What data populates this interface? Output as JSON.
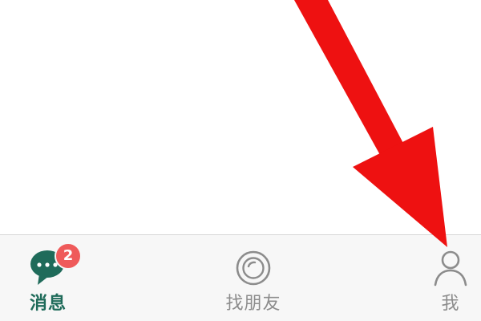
{
  "tabbar": {
    "tabs": [
      {
        "label": "消息",
        "icon": "chat-bubble-icon",
        "badge": "2",
        "active": true
      },
      {
        "label": "找朋友",
        "icon": "radar-icon",
        "active": false
      },
      {
        "label": "我",
        "icon": "person-icon",
        "active": false
      }
    ]
  },
  "colors": {
    "active": "#1f6b5a",
    "inactive": "#8c8c8c",
    "badge": "#ef5a5a",
    "annotation_arrow": "#ee1111",
    "tabbar_background": "#f7f7f7"
  },
  "annotation": {
    "icon": "red-arrow-icon",
    "points_to": "tab-me"
  }
}
